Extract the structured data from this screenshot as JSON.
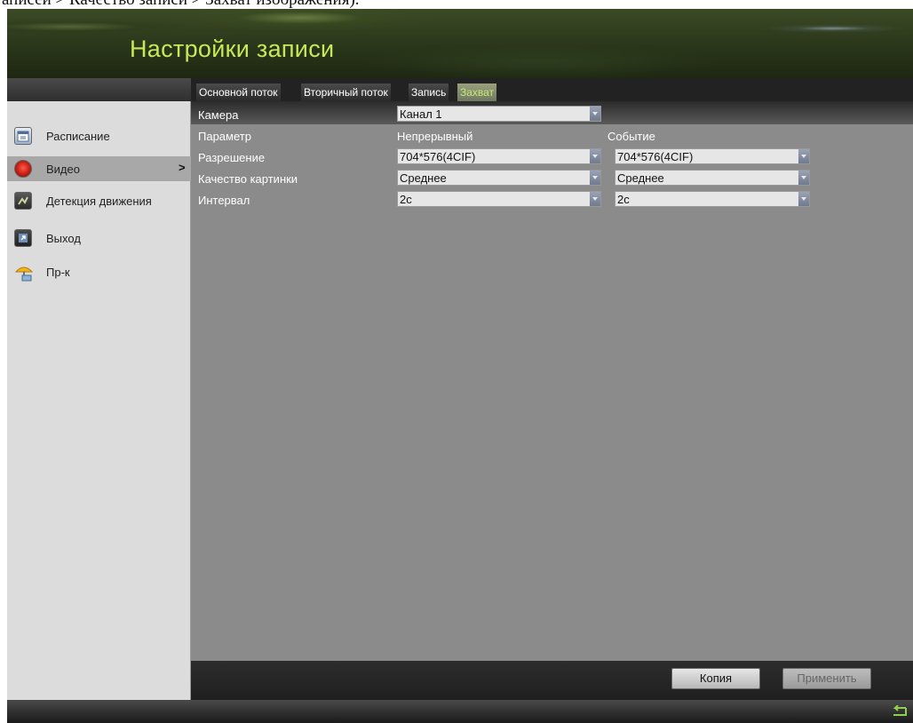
{
  "caption": "аписей > Качество записи > Захват изображения).",
  "header": {
    "title": "Настройки записи"
  },
  "tabs": [
    {
      "label": "Основной поток",
      "active": false
    },
    {
      "label": "Вторичный поток",
      "active": false
    },
    {
      "label": "Запись",
      "active": false
    },
    {
      "label": "Захват",
      "active": true
    }
  ],
  "sidebar": {
    "items": [
      {
        "label": "Расписание",
        "icon": "calendar-icon",
        "selected": false
      },
      {
        "label": "Видео",
        "icon": "camera-icon",
        "selected": true,
        "arrow": ">"
      },
      {
        "label": "Детекция движения",
        "icon": "motion-icon",
        "selected": false
      },
      {
        "label": "Выход",
        "icon": "output-icon",
        "selected": false
      },
      {
        "label": "Пр-к",
        "icon": "umbrella-icon",
        "selected": false
      }
    ]
  },
  "camera": {
    "label": "Камера",
    "value": "Канал 1"
  },
  "params": {
    "header_param": "Параметр",
    "header_continuous": "Непрерывный",
    "header_event": "Событие",
    "rows": [
      {
        "label": "Разрешение",
        "continuous": "704*576(4CIF)",
        "event": "704*576(4CIF)"
      },
      {
        "label": "Качество картинки",
        "continuous": "Среднее",
        "event": "Среднее"
      },
      {
        "label": "Интервал",
        "continuous": "2с",
        "event": "2с"
      }
    ]
  },
  "buttons": {
    "copy": "Копия",
    "apply": "Применить"
  },
  "colors": {
    "title": "#c7e85a",
    "active_tab": "#c8e87a",
    "panel": "#8b8b8b",
    "sidebar": "#dcdcdc"
  }
}
